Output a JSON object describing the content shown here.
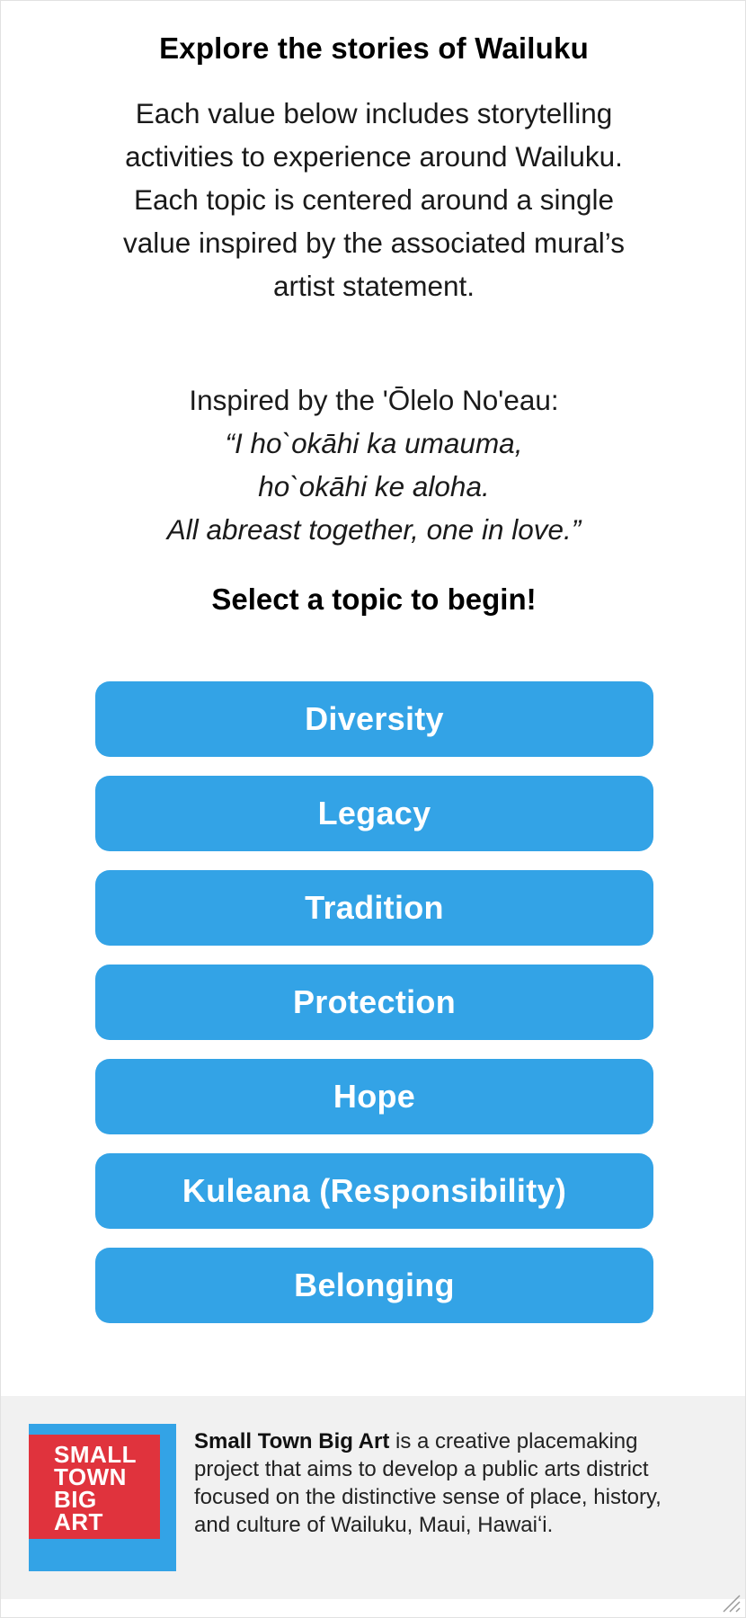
{
  "header": {
    "title": "Explore the stories of Wailuku",
    "intro": "Each value below includes storytelling activities to experience around Wailuku. Each topic is centered around a single value inspired by the associated mural’s artist statement."
  },
  "quote": {
    "lead": "Inspired by the 'Ōlelo No'eau:",
    "line1": "“I ho`okāhi ka umauma,",
    "line2": "ho`okāhi ke aloha.",
    "line3": "All abreast together, one in love.”"
  },
  "prompt": "Select a topic to begin!",
  "topics": [
    "Diversity",
    "Legacy",
    "Tradition",
    "Protection",
    "Hope",
    "Kuleana (Responsibility)",
    "Belonging"
  ],
  "footer": {
    "logo_lines": [
      "SMALL",
      "TOWN",
      "BIG",
      "ART"
    ],
    "org_name": "Small Town Big Art",
    "description": " is a creative placemaking project that aims to develop a public arts district focused on the distinctive sense of place, history, and culture of Wailuku, Maui, Hawaiʻi."
  },
  "colors": {
    "button": "#33a3e6",
    "logo_blue": "#33a3e6",
    "logo_red": "#e0333d",
    "footer_bg": "#f1f1f1"
  },
  "icons": {
    "resize": "resize-grip-icon"
  }
}
